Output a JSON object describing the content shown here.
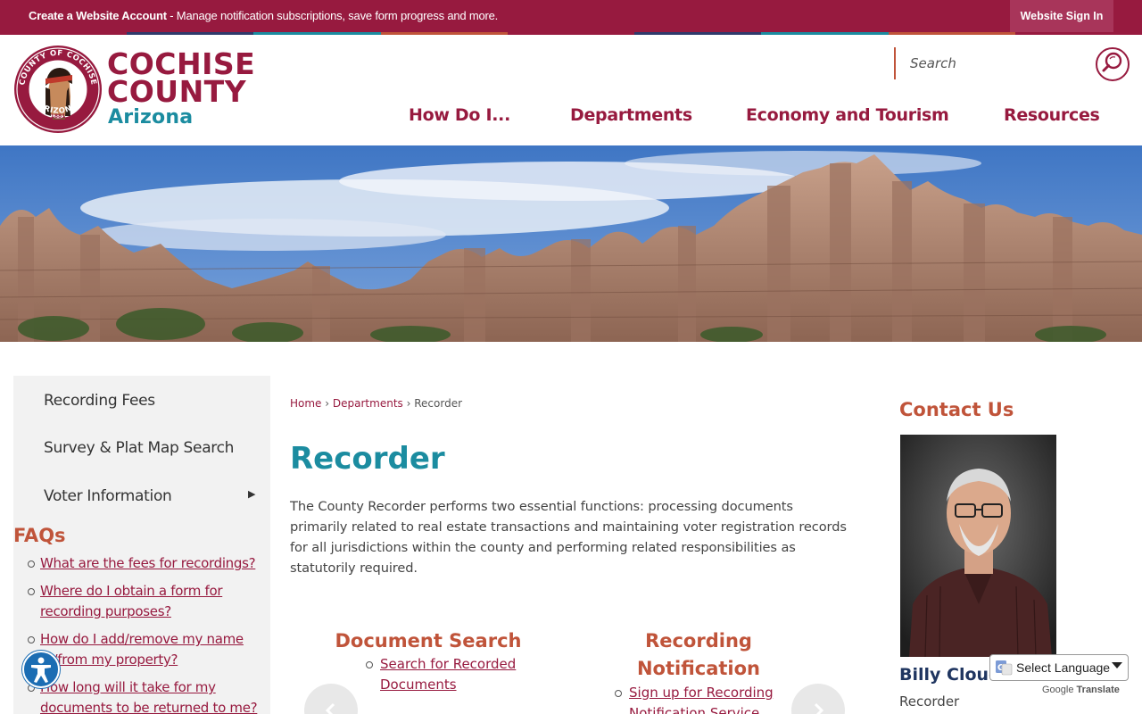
{
  "topbar": {
    "account_bold": "Create a Website Account",
    "account_rest": " - Manage notification subscriptions, save form progress and more.",
    "signin_label": "Website Sign In"
  },
  "brand": {
    "line1": "COCHISE",
    "line2": "COUNTY",
    "line3": "Arizona",
    "seal_top": "COUNTY OF COCHISE",
    "seal_bottom": "ARIZONA",
    "seal_year": "1881"
  },
  "search": {
    "placeholder": "Search"
  },
  "nav": {
    "items": [
      {
        "label": "How Do I..."
      },
      {
        "label": "Departments"
      },
      {
        "label": "Economy and Tourism"
      },
      {
        "label": "Resources"
      }
    ]
  },
  "sidebar": {
    "items": [
      {
        "label": "Recording Fees"
      },
      {
        "label": "Survey & Plat Map Search"
      },
      {
        "label": "Voter Information"
      }
    ],
    "faqs_heading": "FAQs",
    "faqs": [
      "What are the fees for recordings?",
      "Where do I obtain a form for recording purposes?",
      "How do I add/remove my name to/from my property?",
      "How long will it take for my documents to be returned to me?"
    ]
  },
  "breadcrumb": {
    "home": "Home",
    "departments": "Departments",
    "current": "Recorder",
    "sep": "›"
  },
  "main": {
    "title": "Recorder",
    "intro": "The County Recorder performs two essential functions: processing documents primarily related to real estate transactions and maintaining voter registration records for all jurisdictions within the county and performing related responsibilities as statutorily required.",
    "cards": [
      {
        "heading": "Document Search",
        "link": "Search for Recorded Documents"
      },
      {
        "heading": "Recording Notification",
        "link": "Sign up for Recording Notification Service"
      }
    ]
  },
  "contact": {
    "heading": "Contact Us",
    "name": "Billy Cloud",
    "role": "Recorder"
  },
  "translate": {
    "select_label": "Select Language",
    "powered_by": "Google",
    "translate_word": "Translate"
  },
  "colors": {
    "brand": "#971a3f",
    "accent_teal": "#1b8ca0",
    "accent_orange": "#c0543a",
    "stripes": [
      "#971a3f",
      "#2f3a6b",
      "#1b8ca0",
      "#c0543a",
      "#971a3f",
      "#2f3a6b",
      "#1b8ca0",
      "#c0543a",
      "#971a3f"
    ]
  },
  "icons": {
    "search": "search-icon",
    "accessibility": "accessibility-icon",
    "submenu": "chevron-right-icon",
    "prev": "chevron-left-icon",
    "next": "chevron-right-icon",
    "google": "google-g-icon"
  }
}
